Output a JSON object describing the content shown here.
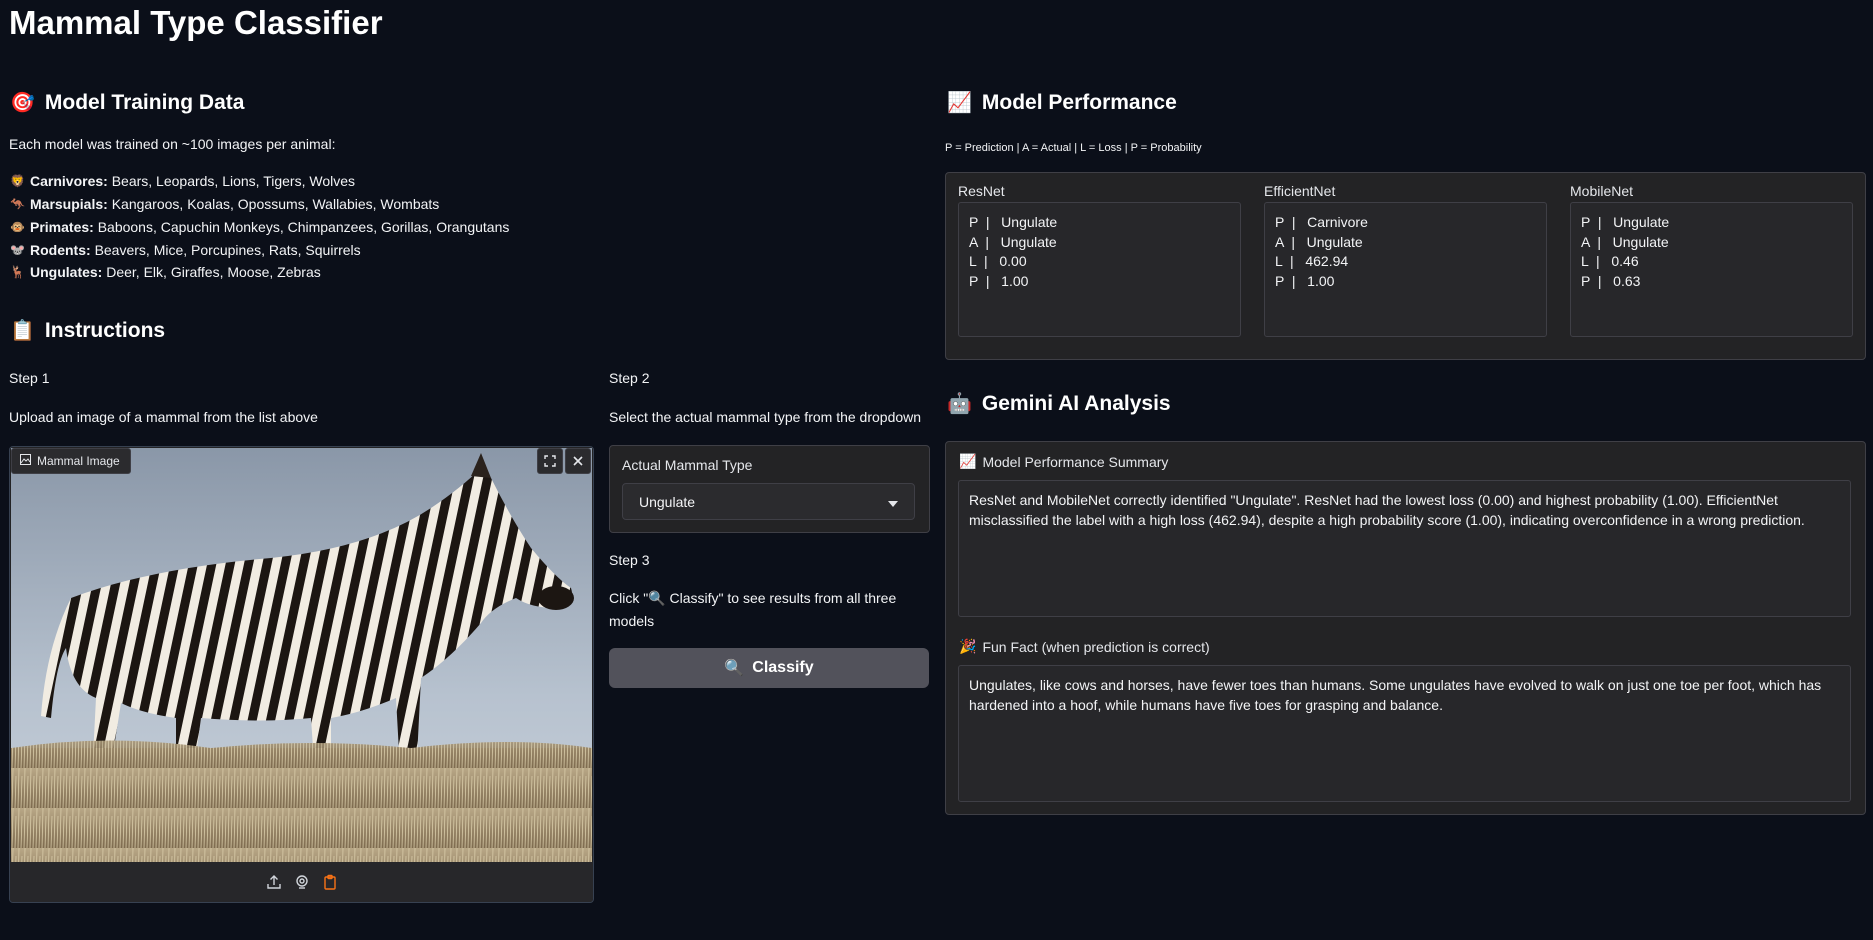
{
  "title": "Mammal Type Classifier",
  "training": {
    "heading": "Model Training Data",
    "intro": "Each model was trained on ~100 images per animal:",
    "items": [
      {
        "icon": "🦁",
        "label": "Carnivores:",
        "text": "Bears, Leopards, Lions, Tigers, Wolves"
      },
      {
        "icon": "🦘",
        "label": "Marsupials:",
        "text": "Kangaroos, Koalas, Opossums, Wallabies, Wombats"
      },
      {
        "icon": "🐵",
        "label": "Primates:",
        "text": "Baboons, Capuchin Monkeys, Chimpanzees, Gorillas, Orangutans"
      },
      {
        "icon": "🐭",
        "label": "Rodents:",
        "text": "Beavers, Mice, Porcupines, Rats, Squirrels"
      },
      {
        "icon": "🦌",
        "label": "Ungulates:",
        "text": "Deer, Elk, Giraffes, Moose, Zebras"
      }
    ]
  },
  "instructions": {
    "heading": "Instructions",
    "step1": "Step 1",
    "step1_text": "Upload an image of a mammal from the list above",
    "step2": "Step 2",
    "step2_text": "Select the actual mammal type from the dropdown",
    "step3": "Step 3",
    "step3_text_a": "Click \"🔍 Classify\" to see results from all three",
    "step3_text_b": "models"
  },
  "image_panel": {
    "label": "Mammal Image"
  },
  "dropdown": {
    "label": "Actual Mammal Type",
    "value": "Ungulate"
  },
  "classify_button": {
    "label": "Classify"
  },
  "performance": {
    "heading": "Model Performance",
    "legend": "P = Prediction | A = Actual | L = Loss | P = Probability",
    "models": [
      {
        "name": "ResNet",
        "rows": [
          "P  |   Ungulate",
          "A  |   Ungulate",
          "L  |   0.00",
          "P  |   1.00"
        ]
      },
      {
        "name": "EfficientNet",
        "rows": [
          "P  |   Carnivore",
          "A  |   Ungulate",
          "L  |   462.94",
          "P  |   1.00"
        ]
      },
      {
        "name": "MobileNet",
        "rows": [
          "P  |   Ungulate",
          "A  |   Ungulate",
          "L  |   0.46",
          "P  |   0.63"
        ]
      }
    ]
  },
  "gemini": {
    "heading": "Gemini AI Analysis",
    "summary_label": "Model Performance Summary",
    "summary_text": "ResNet and MobileNet correctly identified \"Ungulate\". ResNet had the lowest loss (0.00) and highest probability (1.00). EfficientNet misclassified the label with a high loss (462.94), despite a high probability score (1.00), indicating overconfidence in a wrong prediction.",
    "fact_label": "Fun Fact (when prediction is correct)",
    "fact_text": "Ungulates, like cows and horses, have fewer toes than humans. Some ungulates have evolved to walk on just one toe per foot, which has hardened into a hoof, while humans have five toes for grasping and balance."
  }
}
